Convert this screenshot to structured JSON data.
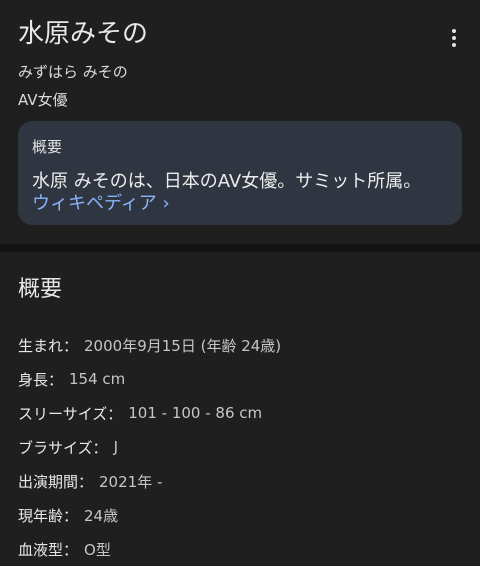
{
  "entity": {
    "title": "水原みその",
    "reading": "みずはら みその",
    "subtitle": "AV女優"
  },
  "summary": {
    "heading": "概要",
    "text": "水原 みそのは、日本のAV女優。サミット所属。",
    "link_label": "ウィキペディア ›"
  },
  "details": {
    "section_title": "概要",
    "facts": [
      {
        "label": "生まれ：",
        "value": "2000年9月15日 (年齢 24歳)"
      },
      {
        "label": "身長：",
        "value": "154 cm"
      },
      {
        "label": "スリーサイズ：",
        "value": "101 - 100 - 86 cm"
      },
      {
        "label": "ブラサイズ：",
        "value": "J"
      },
      {
        "label": "出演期間：",
        "value": "2021年 -"
      },
      {
        "label": "現年齢：",
        "value": "24歳"
      },
      {
        "label": "血液型：",
        "value": "O型"
      }
    ]
  },
  "icons": {
    "more": "more-vert-icon"
  },
  "colors": {
    "background": "#1f1f1f",
    "summary_box": "#2f3541",
    "link": "#8ab4f8"
  }
}
